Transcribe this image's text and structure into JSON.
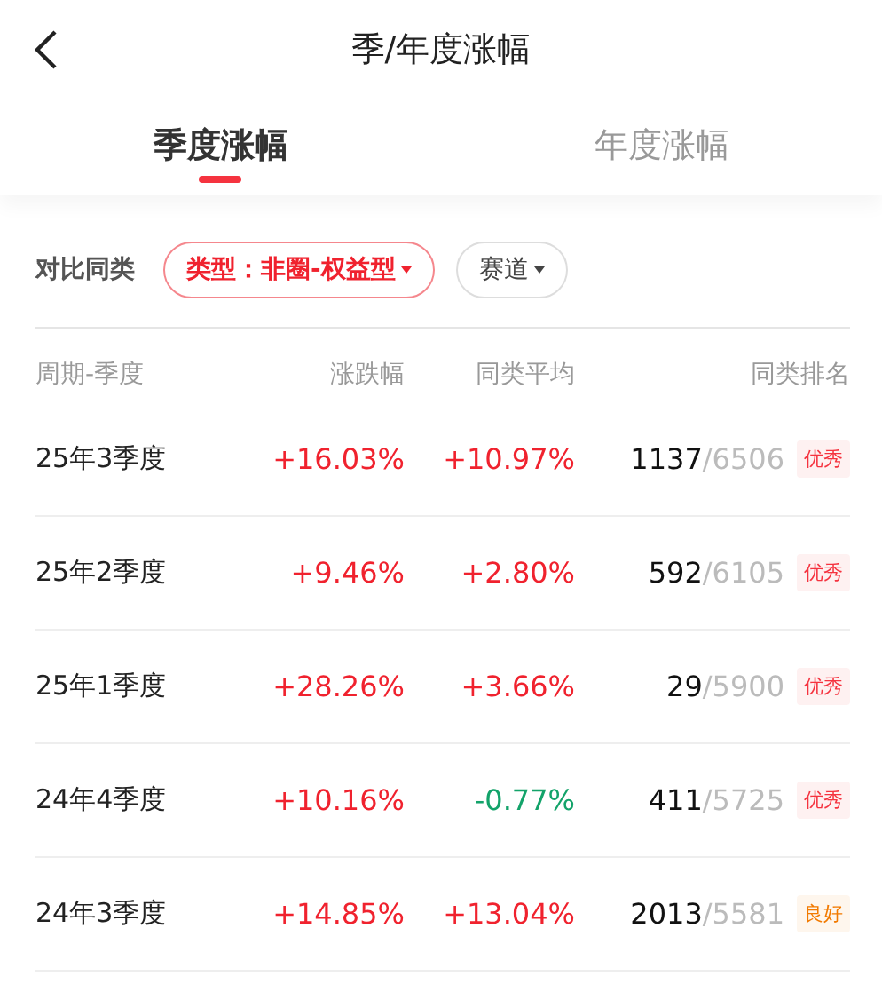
{
  "header": {
    "title": "季/年度涨幅"
  },
  "tabs": [
    {
      "label": "季度涨幅",
      "selected": true
    },
    {
      "label": "年度涨幅",
      "selected": false
    }
  ],
  "filter": {
    "label": "对比同类",
    "chips": [
      {
        "label": "类型：非圈-权益型",
        "selected": true
      },
      {
        "label": "赛道",
        "selected": false
      }
    ]
  },
  "table": {
    "columns": [
      "周期-季度",
      "涨跌幅",
      "同类平均",
      "同类排名"
    ],
    "rows": [
      {
        "period": "25年3季度",
        "change": {
          "text": "+16.03%",
          "negative": false
        },
        "average": {
          "text": "+10.97%",
          "negative": false
        },
        "rank": "1137",
        "total": "/6506",
        "badge": {
          "text": "优秀",
          "color": "#f5333f"
        }
      },
      {
        "period": "25年2季度",
        "change": {
          "text": "+9.46%",
          "negative": false
        },
        "average": {
          "text": "+2.80%",
          "negative": false
        },
        "rank": "592",
        "total": "/6105",
        "badge": {
          "text": "优秀",
          "color": "#f5333f"
        }
      },
      {
        "period": "25年1季度",
        "change": {
          "text": "+28.26%",
          "negative": false
        },
        "average": {
          "text": "+3.66%",
          "negative": false
        },
        "rank": "29",
        "total": "/5900",
        "badge": {
          "text": "优秀",
          "color": "#f5333f"
        }
      },
      {
        "period": "24年4季度",
        "change": {
          "text": "+10.16%",
          "negative": false
        },
        "average": {
          "text": "-0.77%",
          "negative": true
        },
        "rank": "411",
        "total": "/5725",
        "badge": {
          "text": "优秀",
          "color": "#f5333f"
        }
      },
      {
        "period": "24年3季度",
        "change": {
          "text": "+14.85%",
          "negative": false
        },
        "average": {
          "text": "+13.04%",
          "negative": false
        },
        "rank": "2013",
        "total": "/5581",
        "badge": {
          "text": "良好",
          "color": "#f27a00"
        }
      }
    ]
  }
}
